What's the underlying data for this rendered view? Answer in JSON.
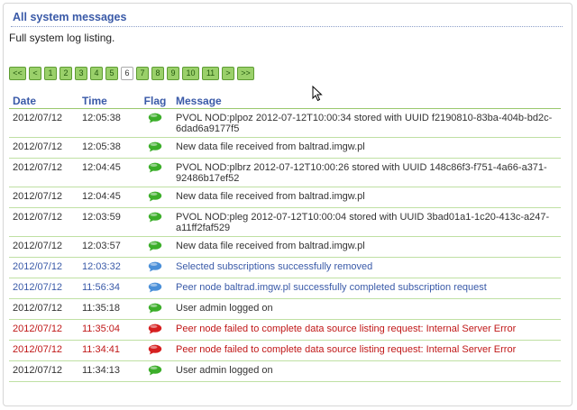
{
  "panel": {
    "title": "All system messages",
    "subtitle": "Full system log listing."
  },
  "pager": [
    {
      "label": "<<",
      "current": false,
      "wide": true
    },
    {
      "label": "<",
      "current": false,
      "wide": false
    },
    {
      "label": "1",
      "current": false,
      "wide": false
    },
    {
      "label": "2",
      "current": false,
      "wide": false
    },
    {
      "label": "3",
      "current": false,
      "wide": false
    },
    {
      "label": "4",
      "current": false,
      "wide": false
    },
    {
      "label": "5",
      "current": false,
      "wide": false
    },
    {
      "label": "6",
      "current": true,
      "wide": false
    },
    {
      "label": "7",
      "current": false,
      "wide": false
    },
    {
      "label": "8",
      "current": false,
      "wide": false
    },
    {
      "label": "9",
      "current": false,
      "wide": false
    },
    {
      "label": "10",
      "current": false,
      "wide": true
    },
    {
      "label": "11",
      "current": false,
      "wide": true
    },
    {
      "label": ">",
      "current": false,
      "wide": false
    },
    {
      "label": ">>",
      "current": false,
      "wide": true
    }
  ],
  "table": {
    "headers": {
      "date": "Date",
      "time": "Time",
      "flag": "Flag",
      "message": "Message"
    },
    "rows": [
      {
        "date": "2012/07/12",
        "time": "12:05:38",
        "level": "ok",
        "message": "PVOL NOD:plpoz 2012-07-12T10:00:34 stored with UUID f2190810-83ba-404b-bd2c-6dad6a9177f5"
      },
      {
        "date": "2012/07/12",
        "time": "12:05:38",
        "level": "ok",
        "message": "New data file received from baltrad.imgw.pl"
      },
      {
        "date": "2012/07/12",
        "time": "12:04:45",
        "level": "ok",
        "message": "PVOL NOD:plbrz 2012-07-12T10:00:26 stored with UUID 148c86f3-f751-4a66-a371-92486b17ef52"
      },
      {
        "date": "2012/07/12",
        "time": "12:04:45",
        "level": "ok",
        "message": "New data file received from baltrad.imgw.pl"
      },
      {
        "date": "2012/07/12",
        "time": "12:03:59",
        "level": "ok",
        "message": "PVOL NOD:pleg 2012-07-12T10:00:04 stored with UUID 3bad01a1-1c20-413c-a247-a11ff2faf529"
      },
      {
        "date": "2012/07/12",
        "time": "12:03:57",
        "level": "ok",
        "message": "New data file received from baltrad.imgw.pl"
      },
      {
        "date": "2012/07/12",
        "time": "12:03:32",
        "level": "info",
        "message": "Selected subscriptions successfully removed"
      },
      {
        "date": "2012/07/12",
        "time": "11:56:34",
        "level": "info",
        "message": "Peer node baltrad.imgw.pl successfully completed subscription request"
      },
      {
        "date": "2012/07/12",
        "time": "11:35:18",
        "level": "ok",
        "message": "User admin logged on"
      },
      {
        "date": "2012/07/12",
        "time": "11:35:04",
        "level": "error",
        "message": "Peer node failed to complete data source listing request: Internal Server Error"
      },
      {
        "date": "2012/07/12",
        "time": "11:34:41",
        "level": "error",
        "message": "Peer node failed to complete data source listing request: Internal Server Error"
      },
      {
        "date": "2012/07/12",
        "time": "11:34:13",
        "level": "ok",
        "message": "User admin logged on"
      }
    ]
  },
  "flag_icons": {
    "ok": {
      "icon": "green-speech-bubble-icon",
      "color": "#3cae2a"
    },
    "info": {
      "icon": "blue-speech-bubble-icon",
      "color": "#4a8fd8"
    },
    "error": {
      "icon": "red-speech-bubble-icon",
      "color": "#d62020"
    }
  }
}
